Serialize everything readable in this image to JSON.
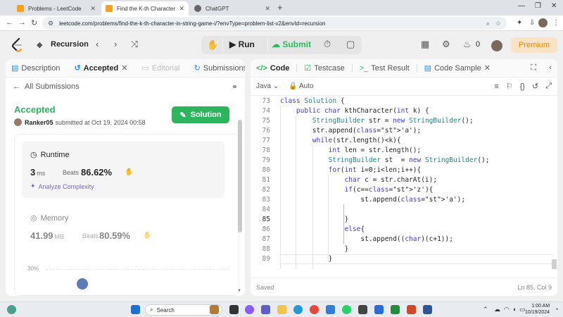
{
  "browser": {
    "tabs": [
      {
        "title": "Problems - LeetCode",
        "active": false,
        "favicon_color": "#f89f1b"
      },
      {
        "title": "Find the K-th Character in String Game I",
        "active": true,
        "favicon_color": "#f89f1b"
      },
      {
        "title": "ChatGPT",
        "active": false,
        "favicon_color": "#555555"
      }
    ],
    "url": "leetcode.com/problems/find-the-k-th-character-in-string-game-i/?envType=problem-list-v2&envId=recursion"
  },
  "topbar": {
    "problem_list": "Recursion",
    "run_label": "Run",
    "submit_label": "Submit",
    "streak_count": "0",
    "premium_label": "Premium"
  },
  "left_panel": {
    "tabs": [
      {
        "label": "Description"
      },
      {
        "label": "Accepted"
      },
      {
        "label": "Editorial"
      },
      {
        "label": "Submissions"
      }
    ],
    "back_label": "All Submissions",
    "status": "Accepted",
    "username": "Ranker05",
    "submitted_text": "submitted at Oct 19, 2024 00:58",
    "solution_button": "Solution",
    "runtime": {
      "label": "Runtime",
      "value": "3",
      "unit": "ms",
      "beats_label": "Beats",
      "beats_value": "86.62%"
    },
    "analyze_label": "Analyze Complexity",
    "memory": {
      "label": "Memory",
      "value": "41.99",
      "unit": "MB",
      "beats_label": "Beats",
      "beats_value": "80.59%"
    },
    "chart_tick": "30%"
  },
  "right_panel": {
    "tabs": [
      {
        "label": "Code"
      },
      {
        "label": "Testcase"
      },
      {
        "label": "Test Result"
      },
      {
        "label": "Code Sample"
      }
    ],
    "language": "Java",
    "mode": "Auto",
    "status_left": "Saved",
    "status_right": "Ln 85, Col 9",
    "code_lines": [
      {
        "n": "73",
        "text": "class Solution {"
      },
      {
        "n": "74",
        "text": "    public char kthCharacter(int k) {"
      },
      {
        "n": "75",
        "text": "        StringBuilder str = new StringBuilder();"
      },
      {
        "n": "76",
        "text": "        str.append('a');"
      },
      {
        "n": "77",
        "text": "        while(str.length()<k){"
      },
      {
        "n": "78",
        "text": "            int len = str.length();"
      },
      {
        "n": "79",
        "text": "            StringBuilder st  = new StringBuilder();"
      },
      {
        "n": "80",
        "text": "            for(int i=0;i<len;i++){"
      },
      {
        "n": "81",
        "text": "                char c = str.charAt(i);"
      },
      {
        "n": "82",
        "text": "                if(c=='z'){"
      },
      {
        "n": "83",
        "text": "                    st.append('a');"
      },
      {
        "n": "84",
        "text": ""
      },
      {
        "n": "85",
        "text": "                }"
      },
      {
        "n": "86",
        "text": "                else{"
      },
      {
        "n": "87",
        "text": "                    st.append((char)(c+1));"
      },
      {
        "n": "88",
        "text": "                }"
      },
      {
        "n": "89",
        "text": "            }"
      }
    ]
  },
  "taskbar": {
    "search_label": "Search",
    "time": "1:00 AM",
    "date": "10/19/2024"
  }
}
